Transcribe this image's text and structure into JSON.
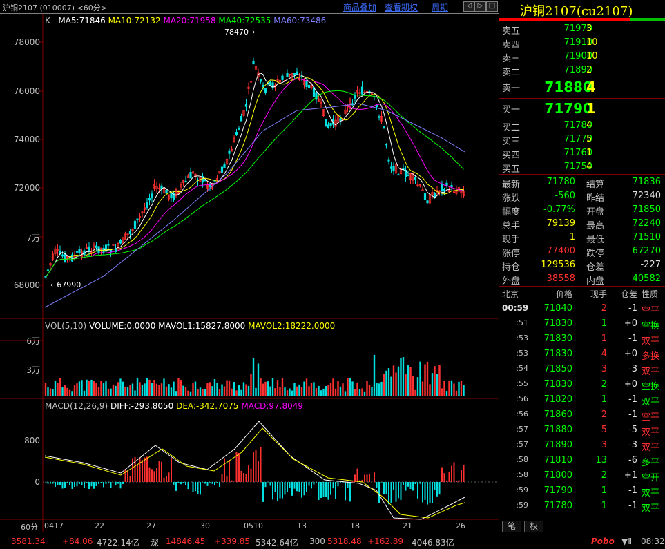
{
  "topbar": {
    "title": "沪铜2107 (010007) <60分>",
    "btn_overlay": "商品叠加",
    "btn_rights": "查看期权",
    "btn_period": "周期"
  },
  "main_chart": {
    "legend_k": "K",
    "ma5": "MA5:71846",
    "ma10": "MA10:72132",
    "ma20": "MA20:71958",
    "ma40": "MA40:72535",
    "ma60": "MA60:73486",
    "y_labels": [
      "78000",
      "76000",
      "74000",
      "72000",
      "7万",
      "68000"
    ],
    "high_mark": "78470",
    "low_mark": "67990",
    "colors": {
      "ma5": "#ffffff",
      "ma10": "#ffff00",
      "ma20": "#ff00ff",
      "ma40": "#00ff00",
      "ma60": "#8080ff"
    }
  },
  "volume_chart": {
    "legend": "VOL(5,10)",
    "volume": "VOLUME:0.0000",
    "mavol1": "MAVOL1:15827.8000",
    "mavol2": "MAVOL2:18222.0000",
    "y_labels": [
      "6万",
      "3万"
    ]
  },
  "macd_chart": {
    "legend": "MACD(12,26,9)",
    "diff": "DIFF:-293.8050",
    "dea": "DEA:-342.7075",
    "macd": "MACD:97.8049",
    "y_labels": [
      "800",
      "0"
    ]
  },
  "x_axis": {
    "period": "60分",
    "labels": [
      "0417",
      "22",
      "27",
      "30",
      "0510",
      "13",
      "18",
      "21",
      "26"
    ]
  },
  "quote": {
    "title": "沪铜2107(cu2107)",
    "asks": [
      {
        "label": "卖五",
        "price": "71970",
        "vol": "3"
      },
      {
        "label": "卖四",
        "price": "71910",
        "vol": "10"
      },
      {
        "label": "卖三",
        "price": "71900",
        "vol": "10"
      },
      {
        "label": "卖二",
        "price": "71890",
        "vol": "2"
      },
      {
        "label": "卖一",
        "price": "71880",
        "vol": "4"
      }
    ],
    "bids": [
      {
        "label": "买一",
        "price": "71790",
        "vol": "1"
      },
      {
        "label": "买二",
        "price": "71780",
        "vol": "4"
      },
      {
        "label": "买三",
        "price": "71770",
        "vol": "5"
      },
      {
        "label": "买四",
        "price": "71760",
        "vol": "1"
      },
      {
        "label": "买五",
        "price": "71750",
        "vol": "4"
      }
    ],
    "stats": [
      {
        "l1": "最新",
        "v1": "71780",
        "c1": "grn",
        "l2": "结算",
        "v2": "71836",
        "c2": "grn"
      },
      {
        "l1": "涨跌",
        "v1": "-560",
        "c1": "grn",
        "l2": "昨结",
        "v2": "72340",
        "c2": "wht"
      },
      {
        "l1": "幅度",
        "v1": "-0.77%",
        "c1": "grn",
        "l2": "开盘",
        "v2": "71850",
        "c2": "grn"
      },
      {
        "l1": "总手",
        "v1": "79139",
        "c1": "yel",
        "l2": "最高",
        "v2": "72240",
        "c2": "grn"
      },
      {
        "l1": "现手",
        "v1": "1",
        "c1": "yel",
        "l2": "最低",
        "v2": "71510",
        "c2": "grn"
      },
      {
        "l1": "涨停",
        "v1": "77400",
        "c1": "red",
        "l2": "跌停",
        "v2": "67270",
        "c2": "grn"
      },
      {
        "l1": "持仓",
        "v1": "129536",
        "c1": "yel",
        "l2": "仓差",
        "v2": "-227",
        "c2": "wht"
      },
      {
        "l1": "外盘",
        "v1": "38558",
        "c1": "red",
        "l2": "内盘",
        "v2": "40582",
        "c2": "grn"
      }
    ]
  },
  "ticks": {
    "headers": [
      "北京",
      "价格",
      "现手",
      "仓差",
      "性质"
    ],
    "rows": [
      {
        "t": "00:59",
        "p": "71840",
        "v": "2",
        "vc": "red",
        "o": "-1",
        "k": "空平",
        "kc": "red"
      },
      {
        "t": ":51",
        "p": "71830",
        "v": "1",
        "vc": "grn",
        "o": "+0",
        "k": "空换",
        "kc": "grn"
      },
      {
        "t": ":53",
        "p": "71830",
        "v": "1",
        "vc": "red",
        "o": "-1",
        "k": "双平",
        "kc": "red"
      },
      {
        "t": ":53",
        "p": "71830",
        "v": "4",
        "vc": "red",
        "o": "+0",
        "k": "多换",
        "kc": "red"
      },
      {
        "t": ":54",
        "p": "71850",
        "v": "3",
        "vc": "red",
        "o": "-3",
        "k": "双平",
        "kc": "red"
      },
      {
        "t": ":55",
        "p": "71830",
        "v": "2",
        "vc": "grn",
        "o": "+0",
        "k": "空换",
        "kc": "grn"
      },
      {
        "t": ":56",
        "p": "71820",
        "v": "1",
        "vc": "grn",
        "o": "-1",
        "k": "双平",
        "kc": "grn"
      },
      {
        "t": ":56",
        "p": "71860",
        "v": "2",
        "vc": "red",
        "o": "-1",
        "k": "空平",
        "kc": "red"
      },
      {
        "t": ":57",
        "p": "71880",
        "v": "5",
        "vc": "red",
        "o": "-5",
        "k": "双平",
        "kc": "red"
      },
      {
        "t": ":57",
        "p": "71890",
        "v": "3",
        "vc": "red",
        "o": "-3",
        "k": "双平",
        "kc": "red"
      },
      {
        "t": ":58",
        "p": "71810",
        "v": "13",
        "vc": "grn",
        "o": "-6",
        "k": "多平",
        "kc": "grn"
      },
      {
        "t": ":58",
        "p": "71800",
        "v": "2",
        "vc": "grn",
        "o": "+1",
        "k": "空开",
        "kc": "grn"
      },
      {
        "t": ":59",
        "p": "71790",
        "v": "1",
        "vc": "grn",
        "o": "-1",
        "k": "双平",
        "kc": "grn"
      },
      {
        "t": ":59",
        "p": "71780",
        "v": "1",
        "vc": "grn",
        "o": "-1",
        "k": "双平",
        "kc": "grn"
      }
    ],
    "tab_trades": "笔",
    "tab_rights": "权"
  },
  "bottombar": {
    "sh_val": "3581.34",
    "sh_chg": "+84.06",
    "sh_amt": "4722.14亿",
    "sz_name": "深",
    "sz_val": "14846.45",
    "sz_chg": "+339.85",
    "sz_amt": "5342.64亿",
    "c300_name": "300",
    "c300_val": "5318.48",
    "c300_chg": "+162.89",
    "c300_amt": "4046.83亿",
    "brand": "Pobo",
    "clock": "08:32"
  }
}
